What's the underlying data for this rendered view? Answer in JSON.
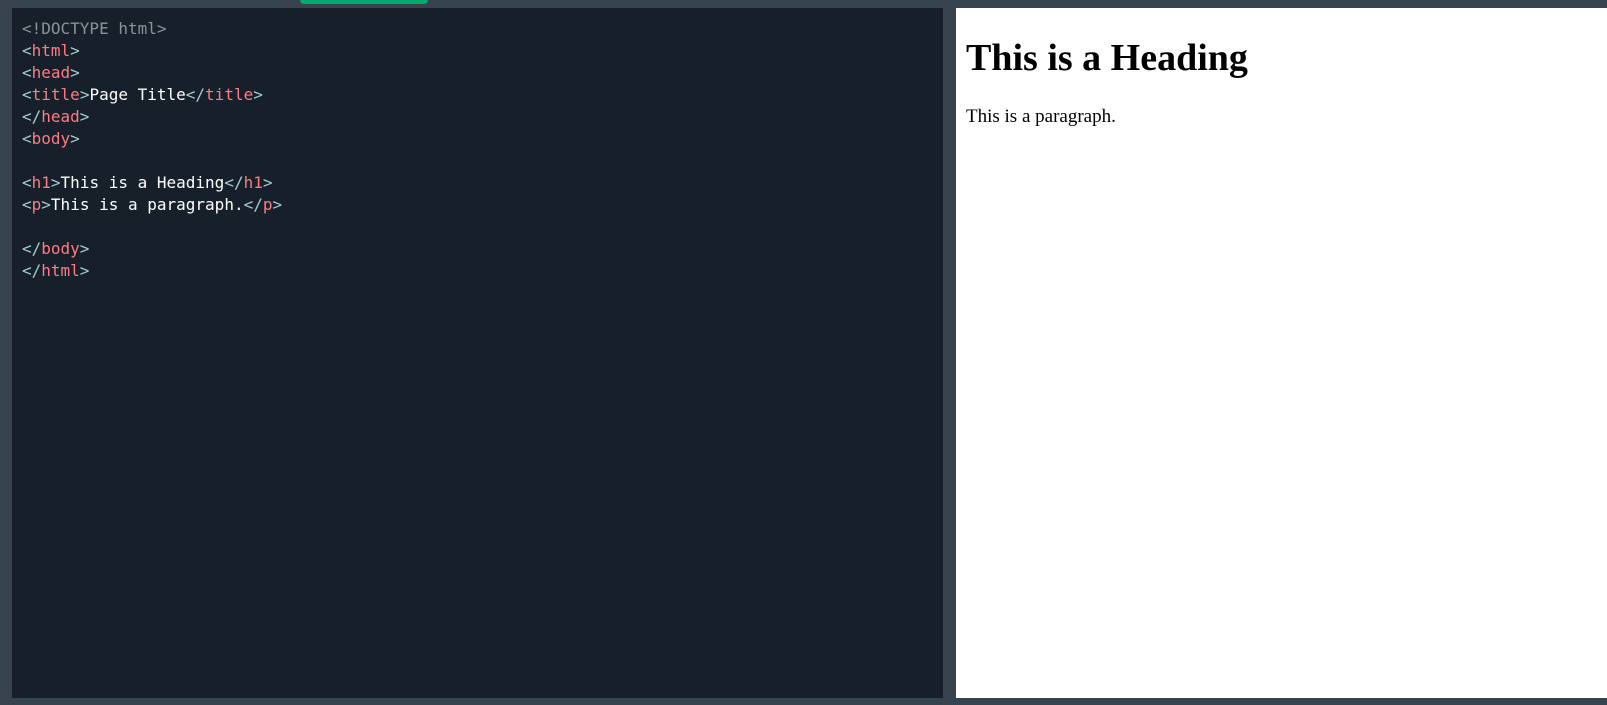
{
  "editor": {
    "lines": [
      {
        "parts": [
          {
            "t": "doctype",
            "v": "<!DOCTYPE html>"
          }
        ]
      },
      {
        "parts": [
          {
            "t": "bracket",
            "v": "<"
          },
          {
            "t": "tag",
            "v": "html"
          },
          {
            "t": "bracket",
            "v": ">"
          }
        ]
      },
      {
        "parts": [
          {
            "t": "bracket",
            "v": "<"
          },
          {
            "t": "tag",
            "v": "head"
          },
          {
            "t": "bracket",
            "v": ">"
          }
        ]
      },
      {
        "parts": [
          {
            "t": "bracket",
            "v": "<"
          },
          {
            "t": "tag",
            "v": "title"
          },
          {
            "t": "bracket",
            "v": ">"
          },
          {
            "t": "text",
            "v": "Page Title"
          },
          {
            "t": "bracket",
            "v": "</"
          },
          {
            "t": "tag",
            "v": "title"
          },
          {
            "t": "bracket",
            "v": ">"
          }
        ]
      },
      {
        "parts": [
          {
            "t": "bracket",
            "v": "</"
          },
          {
            "t": "tag",
            "v": "head"
          },
          {
            "t": "bracket",
            "v": ">"
          }
        ]
      },
      {
        "parts": [
          {
            "t": "bracket",
            "v": "<"
          },
          {
            "t": "tag",
            "v": "body"
          },
          {
            "t": "bracket",
            "v": ">"
          }
        ]
      },
      {
        "parts": []
      },
      {
        "parts": [
          {
            "t": "bracket",
            "v": "<"
          },
          {
            "t": "tag",
            "v": "h1"
          },
          {
            "t": "bracket",
            "v": ">"
          },
          {
            "t": "text",
            "v": "This is a Heading"
          },
          {
            "t": "bracket",
            "v": "</"
          },
          {
            "t": "tag",
            "v": "h1"
          },
          {
            "t": "bracket",
            "v": ">"
          }
        ]
      },
      {
        "parts": [
          {
            "t": "bracket",
            "v": "<"
          },
          {
            "t": "tag",
            "v": "p"
          },
          {
            "t": "bracket",
            "v": ">"
          },
          {
            "t": "text",
            "v": "This is a paragraph."
          },
          {
            "t": "bracket",
            "v": "</"
          },
          {
            "t": "tag",
            "v": "p"
          },
          {
            "t": "bracket",
            "v": ">"
          }
        ]
      },
      {
        "parts": []
      },
      {
        "parts": [
          {
            "t": "bracket",
            "v": "</"
          },
          {
            "t": "tag",
            "v": "body"
          },
          {
            "t": "bracket",
            "v": ">"
          }
        ]
      },
      {
        "parts": [
          {
            "t": "bracket",
            "v": "</"
          },
          {
            "t": "tag",
            "v": "html"
          },
          {
            "t": "bracket",
            "v": ">"
          }
        ]
      }
    ]
  },
  "preview": {
    "heading": "This is a Heading",
    "paragraph": "This is a paragraph."
  },
  "colors": {
    "editor_background": "#17202a",
    "tag": "#ff7b84",
    "bracket": "#9ecfcf",
    "doctype": "#8a9299",
    "text": "#ffffff",
    "frame": "#38444d",
    "accent": "#04aa6d"
  }
}
